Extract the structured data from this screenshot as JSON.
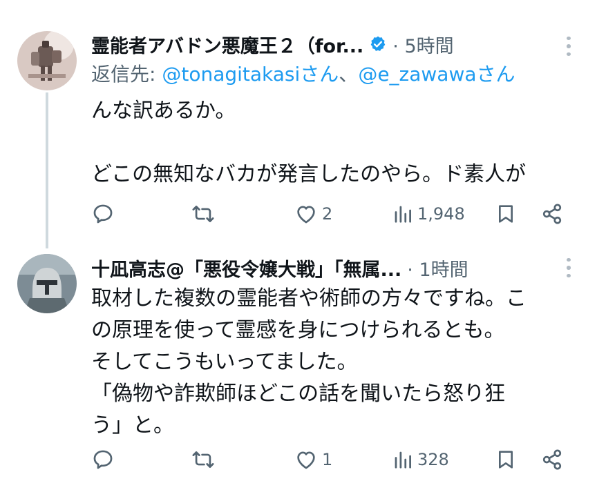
{
  "tweets": [
    {
      "author_name": "霊能者アバドン悪魔王２（for...",
      "time": "5時間",
      "reply_prefix": "返信先: ",
      "mention1": "@tonagitakasiさん",
      "reply_sep": "、",
      "mention2": "@e_zawawaさん",
      "text": "んな訳あるか。\n\nどこの無知なバカが発言したのやら。ド素人が",
      "likes": "2",
      "views": "1,948"
    },
    {
      "author_name": "十凪高志@「悪役令嬢大戦」「無属...",
      "time": "1時間",
      "text": "取材した複数の霊能者や術師の方々ですね。こ\nの原理を使って霊感を身につけられるとも。\nそしてこうもいってました。\n「偽物や詐欺師ほどこの話を聞いたら怒り狂\nう」と。",
      "likes": "1",
      "views": "328"
    }
  ],
  "icons": {
    "reply": "reply-icon",
    "retweet": "retweet-icon",
    "like": "heart-icon",
    "views": "views-icon",
    "bookmark": "bookmark-icon",
    "share": "share-icon",
    "verified": "verified-badge-icon",
    "more": "more-icon"
  },
  "colors": {
    "text": "#0f1419",
    "secondary": "#536471",
    "accent": "#1d9bf0",
    "thread_line": "#cfd9de"
  }
}
